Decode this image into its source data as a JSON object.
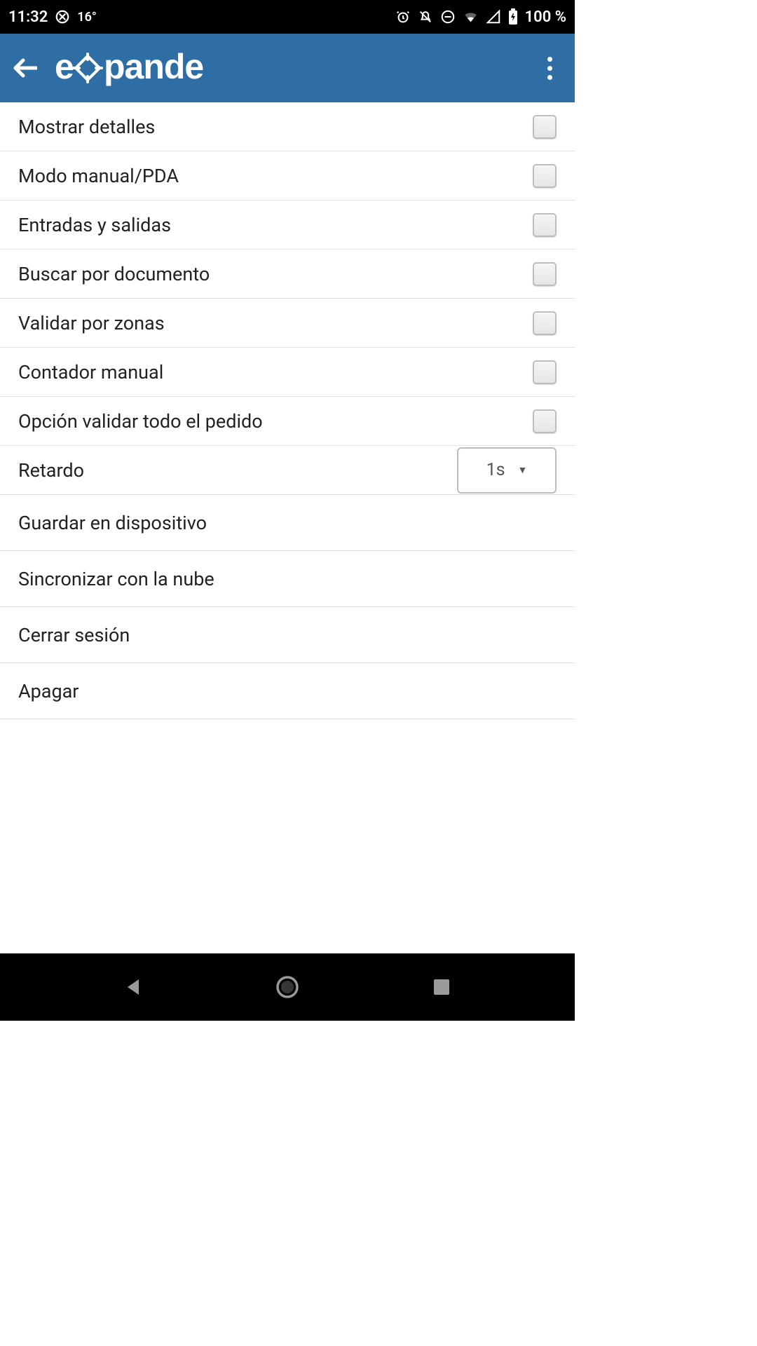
{
  "status_bar": {
    "time": "11:32",
    "temp": "16°",
    "battery": "100 %"
  },
  "app": {
    "title": "expande"
  },
  "settings": {
    "items": [
      {
        "label": "Mostrar detalles",
        "checked": false
      },
      {
        "label": "Modo manual/PDA",
        "checked": false
      },
      {
        "label": "Entradas y salidas",
        "checked": false
      },
      {
        "label": "Buscar por documento",
        "checked": false
      },
      {
        "label": "Validar por zonas",
        "checked": false
      },
      {
        "label": "Contador manual",
        "checked": false
      },
      {
        "label": "Opción validar todo el pedido",
        "checked": false
      }
    ],
    "delay": {
      "label": "Retardo",
      "value": "1s"
    },
    "actions": [
      {
        "label": "Guardar en dispositivo"
      },
      {
        "label": "Sincronizar con la nube"
      },
      {
        "label": "Cerrar sesión"
      },
      {
        "label": "Apagar"
      }
    ]
  }
}
